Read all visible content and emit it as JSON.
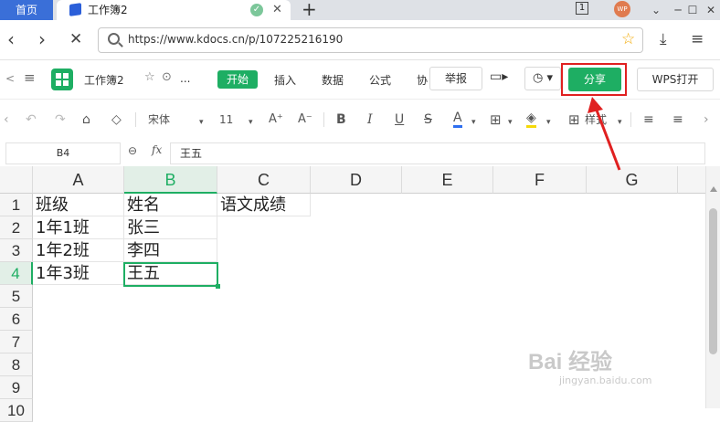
{
  "browser": {
    "home_tab": "首页",
    "doc_tab_title": "工作簿2",
    "tab_count": "1",
    "avatar_text": "WP",
    "url": "https://www.kdocs.cn/p/107225216190"
  },
  "app": {
    "doc_title": "工作簿2",
    "more": "...",
    "menu": {
      "start": "开始",
      "insert": "插入",
      "data": "数据",
      "formula": "公式",
      "collab": "协"
    },
    "report": "举报",
    "share": "分享",
    "wps_open": "WPS打开"
  },
  "format_toolbar": {
    "font_name": "宋体",
    "font_size": "11",
    "bold": "B",
    "italic": "I",
    "underline": "U",
    "strikethrough": "S",
    "font_color": "A",
    "style": "样式"
  },
  "formula_bar": {
    "cell_ref": "B4",
    "fx": "fx",
    "value": "王五"
  },
  "sheet": {
    "columns": [
      "A",
      "B",
      "C",
      "D",
      "E",
      "F",
      "G"
    ],
    "rows": [
      "1",
      "2",
      "3",
      "4",
      "5",
      "6",
      "7",
      "8",
      "9",
      "10"
    ],
    "cells": {
      "A1": "班级",
      "B1": "姓名",
      "C1": "语文成绩",
      "A2": "1年1班",
      "B2": "张三",
      "A3": "1年2班",
      "B3": "李四",
      "A4": "1年3班",
      "B4": "王五"
    },
    "selected_cell": "B4"
  },
  "watermark": {
    "brand": "Bai 经验",
    "site": "jingyan.baidu.com"
  },
  "colors": {
    "accent_green": "#1eae63",
    "annotation_red": "#e02020"
  }
}
